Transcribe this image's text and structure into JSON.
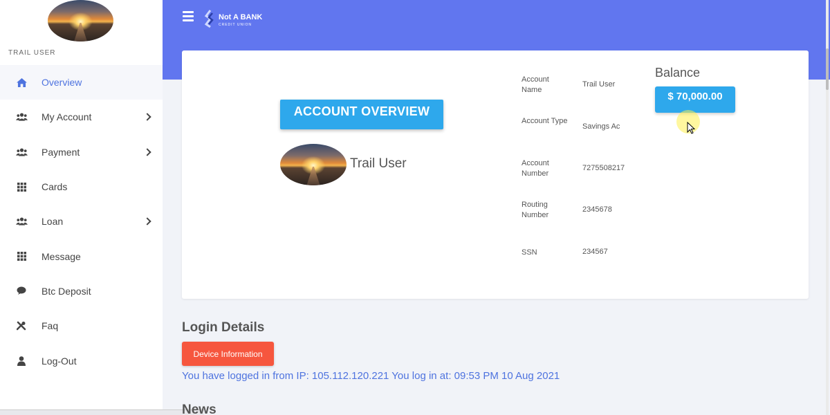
{
  "sidebar": {
    "user_label": "TRAIL USER",
    "items": [
      {
        "label": "Overview",
        "icon": "home-icon",
        "active": true,
        "chevron": false
      },
      {
        "label": "My Account",
        "icon": "users-icon",
        "active": false,
        "chevron": true
      },
      {
        "label": "Payment",
        "icon": "users-icon",
        "active": false,
        "chevron": true
      },
      {
        "label": "Cards",
        "icon": "grid-icon",
        "active": false,
        "chevron": false
      },
      {
        "label": "Loan",
        "icon": "users-icon",
        "active": false,
        "chevron": true
      },
      {
        "label": "Message",
        "icon": "grid-icon",
        "active": false,
        "chevron": false
      },
      {
        "label": "Btc Deposit",
        "icon": "comment-icon",
        "active": false,
        "chevron": false
      },
      {
        "label": "Faq",
        "icon": "tools-icon",
        "active": false,
        "chevron": false
      },
      {
        "label": "Log-Out",
        "icon": "user-icon",
        "active": false,
        "chevron": false
      }
    ]
  },
  "topbar": {
    "logo_main": "Not A BANK",
    "logo_sub": "CREDIT UNION",
    "color": "#6176ef"
  },
  "overview": {
    "title": "ACCOUNT OVERVIEW",
    "username": "Trail User",
    "fields": [
      {
        "label": "Account Name",
        "value": "Trail User"
      },
      {
        "label": "Account Type",
        "value": "Savings Ac"
      },
      {
        "label": "Account Number",
        "value": "7275508217"
      },
      {
        "label": "Routing Number",
        "value": "2345678"
      },
      {
        "label": "SSN",
        "value": "234567"
      }
    ],
    "balance_title": "Balance",
    "balance_value": "$ 70,000.00"
  },
  "login": {
    "title": "Login Details",
    "device_button": "Device Information",
    "message": "You have logged in from IP: 105.112.120.221 You log in at: 09:53 PM 10 Aug 2021"
  },
  "news": {
    "title": "News"
  },
  "colors": {
    "accent": "#4e73df",
    "button_blue": "#2ea8ec",
    "button_red": "#f6563e"
  }
}
